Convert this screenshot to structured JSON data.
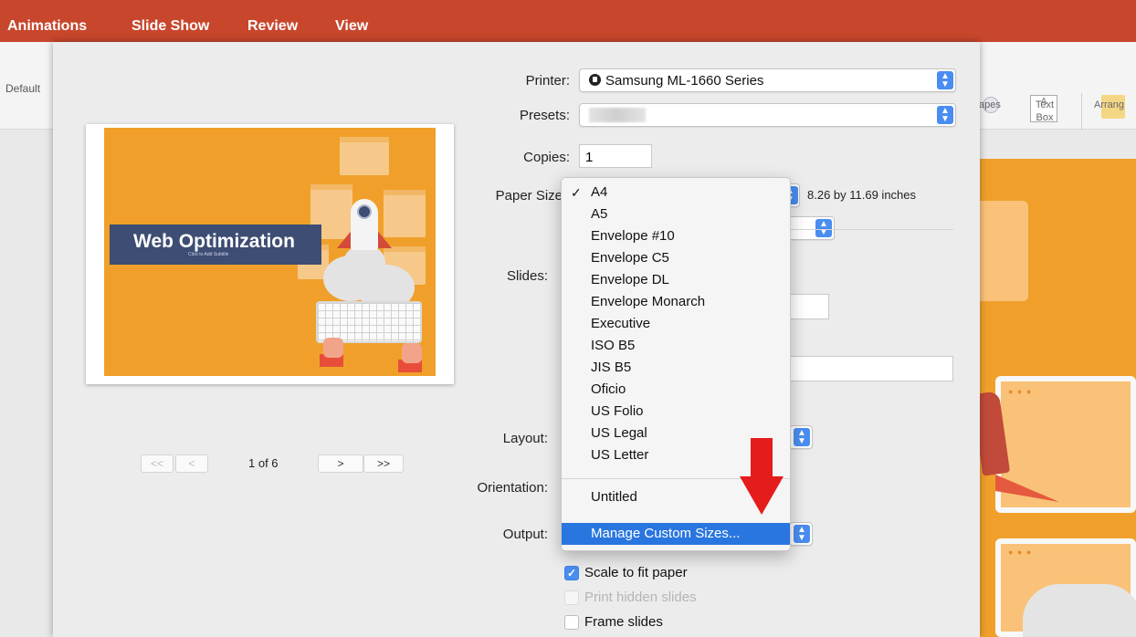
{
  "menubar": {
    "items": [
      "Animations",
      "Slide Show",
      "Review",
      "View"
    ]
  },
  "ribbon": {
    "default_label": "Default",
    "shapes_label": "apes",
    "textbox_label": "Text\nBox",
    "textbox_glyph": "A",
    "arrange_label": "Arrang"
  },
  "preview": {
    "slide_title": "Web Optimization",
    "slide_subtitle": "Click to Add Subtitle"
  },
  "pager": {
    "first": "<<",
    "prev": "<",
    "page_text": "1 of 6",
    "next": ">",
    "last": ">>"
  },
  "form": {
    "printer_label": "Printer:",
    "printer_value": "Samsung ML-1660 Series",
    "presets_label": "Presets:",
    "copies_label": "Copies:",
    "copies_value": "1",
    "paper_size_label": "Paper Size",
    "paper_dims": "8.26 by 11.69 inches",
    "slides_label": "Slides:",
    "layout_label": "Layout:",
    "orientation_label": "Orientation:",
    "output_label": "Output:"
  },
  "checkboxes": [
    {
      "label": "Scale to fit paper",
      "checked": true,
      "disabled": false
    },
    {
      "label": "Print hidden slides",
      "checked": false,
      "disabled": true
    },
    {
      "label": "Frame slides",
      "checked": false,
      "disabled": false
    }
  ],
  "paper_dropdown": {
    "checkmark": "✓",
    "items": [
      "A4",
      "A5",
      "Envelope #10",
      "Envelope C5",
      "Envelope DL",
      "Envelope Monarch",
      "Executive",
      "ISO B5",
      "JIS B5",
      "Oficio",
      "US Folio",
      "US Legal",
      "US Letter"
    ],
    "selected": "A4",
    "custom_item": "Untitled",
    "manage_item": "Manage Custom Sizes..."
  },
  "colors": {
    "menubar": "#c8462c",
    "accent": "#4a8df0",
    "highlight": "#2a76e0",
    "slide_orange": "#f0a02a",
    "title_bar": "#3d4d73",
    "arrow": "#e41c1c"
  },
  "icons": [
    "printer-status-icon",
    "popup-stepper-icon",
    "checkmark-icon",
    "red-arrow-icon",
    "shapes-icon",
    "textbox-icon",
    "arrange-icon"
  ]
}
